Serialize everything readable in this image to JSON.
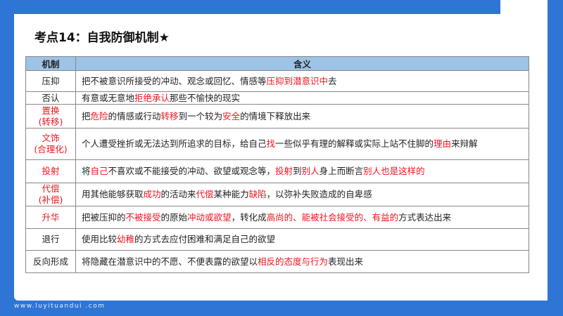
{
  "title": "考点14：自我防御机制★",
  "headers": [
    "机制",
    "含义"
  ],
  "accent_color": "#f0141e",
  "rows": [
    {
      "name": [
        "压抑"
      ],
      "red_name": false,
      "h": 30,
      "parts": [
        [
          "把不被意识所接受的冲动、观念或回忆、情感等",
          0
        ],
        [
          "压抑到潜意识中",
          1
        ],
        [
          "去",
          0
        ]
      ]
    },
    {
      "name": [
        "否认"
      ],
      "red_name": false,
      "h": 18,
      "parts": [
        [
          "有意或无意地",
          0
        ],
        [
          "拒绝承认",
          1
        ],
        [
          "那些不愉快的现实",
          0
        ]
      ]
    },
    {
      "name": [
        "置换",
        "(转移)"
      ],
      "red_name": true,
      "h": 34,
      "parts": [
        [
          "把",
          0
        ],
        [
          "危险",
          1
        ],
        [
          "的情感或行动",
          0
        ],
        [
          "转移",
          1
        ],
        [
          "到一个较为",
          0
        ],
        [
          "安全",
          1
        ],
        [
          "的情境下释放出来",
          0
        ]
      ]
    },
    {
      "name": [
        "文饰",
        "(合理化)"
      ],
      "red_name": true,
      "h": 45,
      "parts": [
        [
          "个人遭受挫折或无法达到所追求的目标，给自己",
          0
        ],
        [
          "找",
          1
        ],
        [
          "一些似乎有理的解释或实际上站不住脚的",
          0
        ],
        [
          "理由",
          1
        ],
        [
          "来辩解",
          0
        ]
      ]
    },
    {
      "name": [
        "投射"
      ],
      "red_name": true,
      "h": 33,
      "parts": [
        [
          "将",
          0
        ],
        [
          "自己",
          1
        ],
        [
          "不喜欢或不能接受的冲动、欲望或观念等，",
          0
        ],
        [
          "投射",
          1
        ],
        [
          "到",
          0
        ],
        [
          "别人",
          1
        ],
        [
          "身上而断言",
          0
        ],
        [
          "别人也是这样的",
          1
        ]
      ]
    },
    {
      "name": [
        "代偿",
        "(补偿)"
      ],
      "red_name": true,
      "h": 32,
      "parts": [
        [
          "用其他能够获取",
          0
        ],
        [
          "成功",
          1
        ],
        [
          "的活动来",
          0
        ],
        [
          "代偿",
          1
        ],
        [
          "某种能力",
          0
        ],
        [
          "缺陷",
          1
        ],
        [
          "，以弥补失败造成的自卑感",
          0
        ]
      ]
    },
    {
      "name": [
        "升华"
      ],
      "red_name": true,
      "h": 32,
      "parts": [
        [
          "把被压抑的",
          0
        ],
        [
          "不被接受",
          1
        ],
        [
          "的原始",
          0
        ],
        [
          "冲动或欲望",
          1
        ],
        [
          "，转化成",
          0
        ],
        [
          "高尚的、能被社会接受的、有益的",
          1
        ],
        [
          "方式表达出来",
          0
        ]
      ]
    },
    {
      "name": [
        "退行"
      ],
      "red_name": false,
      "h": 31,
      "parts": [
        [
          "使用比较",
          0
        ],
        [
          "幼稚",
          1
        ],
        [
          "的方式去应付困难和满足自己的欲望",
          0
        ]
      ]
    },
    {
      "name": [
        "反向形成"
      ],
      "red_name": false,
      "h": 32,
      "parts": [
        [
          "将隐藏在潜意识中的不愿、不便表露的欲望以",
          0
        ],
        [
          "相反的态度与行为",
          1
        ],
        [
          "表现出来",
          0
        ]
      ]
    }
  ],
  "footer": "www.luyituandui .com"
}
